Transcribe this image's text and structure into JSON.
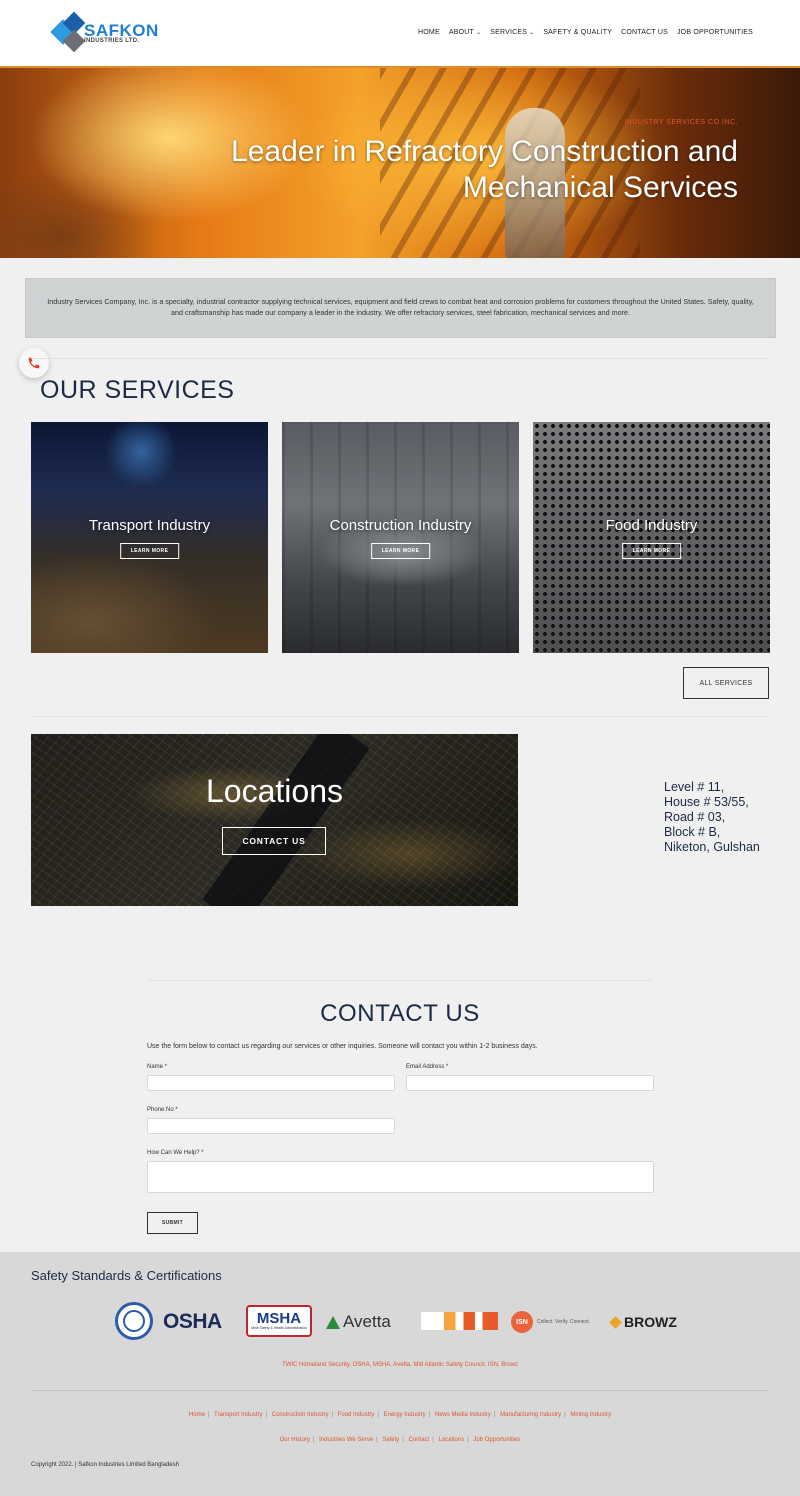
{
  "header": {
    "logo_name": "SAFKON",
    "logo_sub": "INDUSTRIES LTD.",
    "nav": [
      {
        "label": "HOME",
        "caret": false
      },
      {
        "label": "ABOUT",
        "caret": true
      },
      {
        "label": "SERVICES",
        "caret": true
      },
      {
        "label": "SAFETY & QUALITY",
        "caret": false
      },
      {
        "label": "CONTACT US",
        "caret": false
      },
      {
        "label": "JOB OPPORTUNITIES",
        "caret": false
      }
    ]
  },
  "hero": {
    "kicker": "INDUSTRY SERVICES CO INC.",
    "title_line1": "Leader in Refractory Construction and",
    "title_line2": "Mechanical Services"
  },
  "intro": {
    "text": "Industry Services Company, Inc. is a specialty, industrial contractor supplying technical services, equipment and field crews to combat heat and corrosion problems for customers throughout the United States. Safety, quality, and craftsmanship has made our company a leader in the industry. We offer refractory services, steel fabrication, mechanical services and more."
  },
  "services": {
    "title": "OUR SERVICES",
    "cards": [
      {
        "label": "Transport Industry",
        "button": "LEARN MORE"
      },
      {
        "label": "Construction Industry",
        "button": "LEARN MORE"
      },
      {
        "label": "Food Industry",
        "button": "LEARN MORE"
      }
    ],
    "all_button": "ALL SERVICES"
  },
  "locations": {
    "title": "Locations",
    "button": "CONTACT US",
    "address": [
      "Level # 11,",
      "House # 53/55,",
      "Road # 03,",
      "Block # B,",
      "Niketon, Gulshan"
    ]
  },
  "contact": {
    "title": "CONTACT US",
    "description": "Use the form below to contact us regarding our services or other inquiries. Someone will contact you within 1-2 business days.",
    "name_label": "Name *",
    "email_label": "Email Address *",
    "phone_label": "Phone No *",
    "help_label": "How Can We Help? *",
    "name_value": "",
    "email_value": "",
    "phone_value": "",
    "help_value": "",
    "submit": "SUBMIT"
  },
  "footer": {
    "safety_title": "Safety Standards & Certifications",
    "logos": {
      "osha": "OSHA",
      "msha": "MSHA",
      "msha_sub": "Mine Safety & Health Administration",
      "avetta": "Avetta",
      "isn": "ISN",
      "isn_tag": "Collect. Verify. Connect.",
      "browz": "BROWZ"
    },
    "cert_line": "TWIC Homeland Security, OSHA, MSHA, Avetta, Mid Atlantic Safety Council, ISN, Browz",
    "links_row1": [
      "Home",
      "Transport Industry",
      "Construction Industry",
      "Food Industry",
      "Energy Industry",
      "News Media Industry",
      "Manufacturing Industry",
      "Mining Industry"
    ],
    "links_row2": [
      "Our History",
      "Industries We Serve",
      "Safety",
      "Contact",
      "Locations",
      "Job Opportunities"
    ],
    "copyright": "Copyright 2022. | Safkon Industries Limited Bangladesh"
  },
  "icons": {
    "phone": "phone-icon",
    "caret": "chevron-down-icon"
  },
  "colors": {
    "accent_orange": "#e0552a",
    "navy": "#1d2a44",
    "logo_blue": "#1f7fd0"
  }
}
